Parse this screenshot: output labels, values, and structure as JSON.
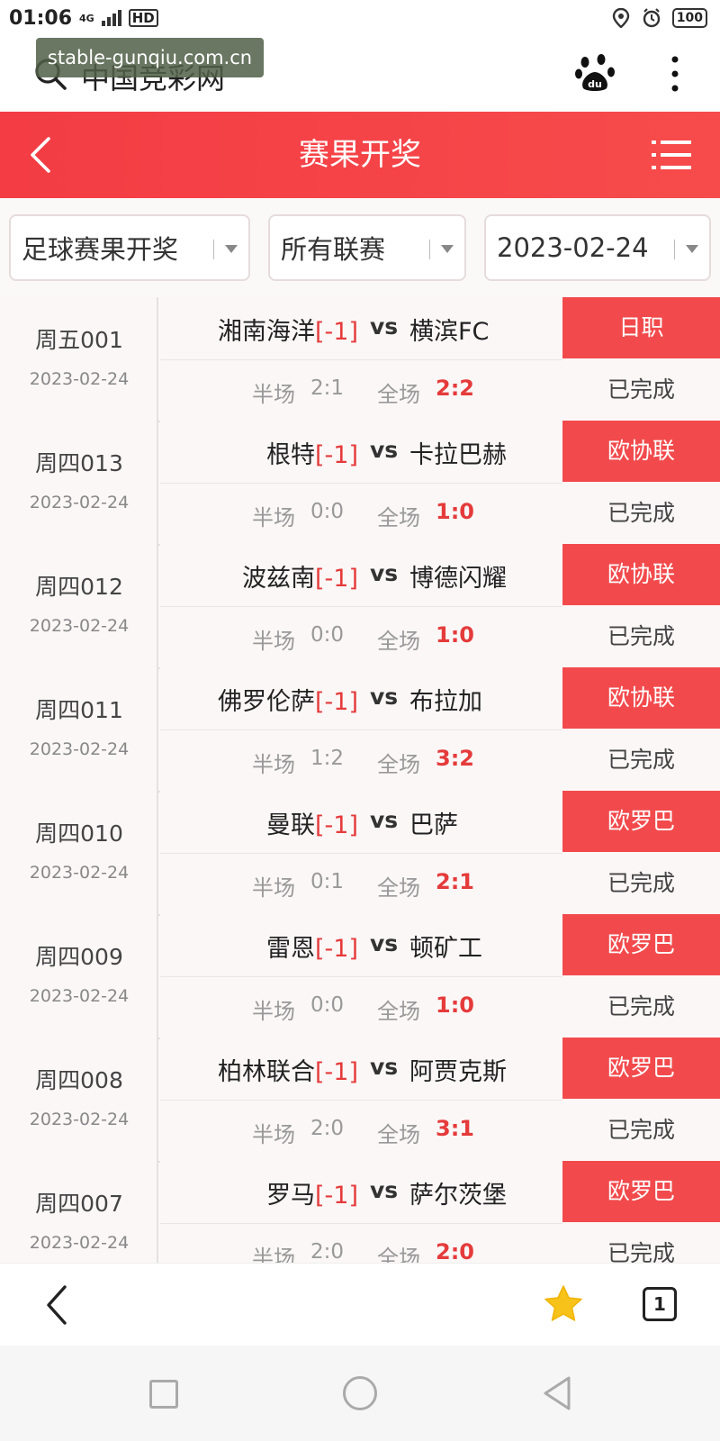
{
  "status_bar": {
    "time": "01:06",
    "network": "4G",
    "hd": "HD",
    "battery": "100"
  },
  "browser": {
    "title": "中国竞彩网",
    "watermark": "stable-gunqiu.com.cn"
  },
  "header": {
    "title": "赛果开奖"
  },
  "filters": {
    "type": "足球赛果开奖",
    "league": "所有联赛",
    "date": "2023-02-24"
  },
  "labels": {
    "half": "半场",
    "full": "全场",
    "vs": "vs"
  },
  "matches": [
    {
      "code": "周五001",
      "date": "2023-02-24",
      "home": "湘南海洋",
      "handicap": "[-1]",
      "away": "横滨FC",
      "half_score": "2:1",
      "full_score": "2:2",
      "league": "日职",
      "status": "已完成"
    },
    {
      "code": "周四013",
      "date": "2023-02-24",
      "home": "根特",
      "handicap": "[-1]",
      "away": "卡拉巴赫",
      "half_score": "0:0",
      "full_score": "1:0",
      "league": "欧协联",
      "status": "已完成"
    },
    {
      "code": "周四012",
      "date": "2023-02-24",
      "home": "波兹南",
      "handicap": "[-1]",
      "away": "博德闪耀",
      "half_score": "0:0",
      "full_score": "1:0",
      "league": "欧协联",
      "status": "已完成"
    },
    {
      "code": "周四011",
      "date": "2023-02-24",
      "home": "佛罗伦萨",
      "handicap": "[-1]",
      "away": "布拉加",
      "half_score": "1:2",
      "full_score": "3:2",
      "league": "欧协联",
      "status": "已完成"
    },
    {
      "code": "周四010",
      "date": "2023-02-24",
      "home": "曼联",
      "handicap": "[-1]",
      "away": "巴萨",
      "half_score": "0:1",
      "full_score": "2:1",
      "league": "欧罗巴",
      "status": "已完成"
    },
    {
      "code": "周四009",
      "date": "2023-02-24",
      "home": "雷恩",
      "handicap": "[-1]",
      "away": "顿矿工",
      "half_score": "0:0",
      "full_score": "1:0",
      "league": "欧罗巴",
      "status": "已完成"
    },
    {
      "code": "周四008",
      "date": "2023-02-24",
      "home": "柏林联合",
      "handicap": "[-1]",
      "away": "阿贾克斯",
      "half_score": "2:0",
      "full_score": "3:1",
      "league": "欧罗巴",
      "status": "已完成"
    },
    {
      "code": "周四007",
      "date": "2023-02-24",
      "home": "罗马",
      "handicap": "[-1]",
      "away": "萨尔茨堡",
      "half_score": "2:0",
      "full_score": "2:0",
      "league": "欧罗巴",
      "status": "已完成"
    }
  ],
  "bottom_bar": {
    "tab_count": "1"
  },
  "icons": {
    "search": "search-icon",
    "baidu": "baidu-paw-icon",
    "more": "more-vertical-icon",
    "back": "chevron-left-icon",
    "menu": "list-menu-icon",
    "star": "star-icon",
    "tabs": "tabs-icon"
  },
  "colors": {
    "accent_red": "#f24a4c",
    "score_red": "#e53b3b",
    "star_yellow": "#f7c21a"
  }
}
